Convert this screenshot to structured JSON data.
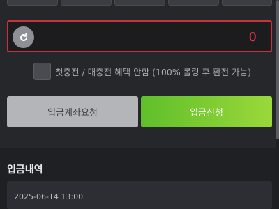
{
  "amount": {
    "value": "0",
    "reset_icon": "refresh-icon"
  },
  "notice": {
    "checked": false,
    "text": "첫충전 / 매충전 혜택 안함 (100% 롤링 후 환전 가능)"
  },
  "buttons": {
    "request_account": "입금계좌요청",
    "deposit_request": "입금신청"
  },
  "history": {
    "title": "입금내역",
    "items": [
      {
        "date": "2025-06-14 13:00"
      }
    ]
  },
  "colors": {
    "background": "#26272b",
    "amount_border": "#c8323c",
    "amount_text": "#e4344a",
    "deposit_button": "#7ccb32",
    "account_button": "#b4b5b9"
  }
}
